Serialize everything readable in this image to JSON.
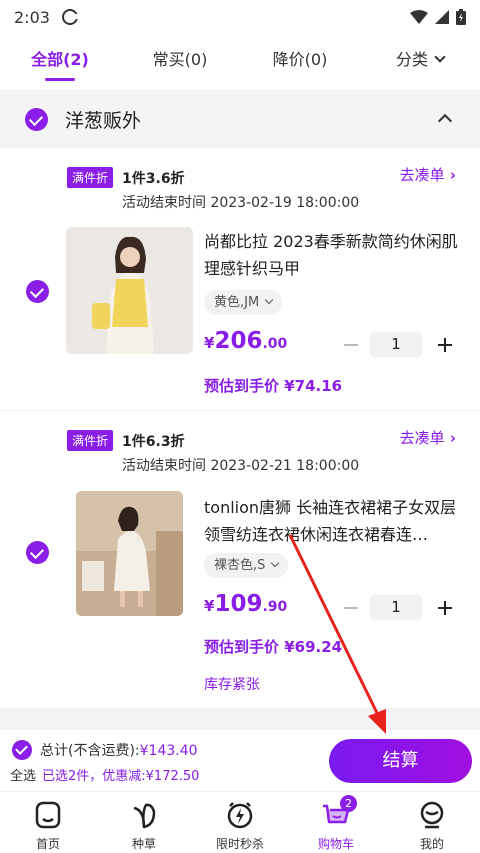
{
  "status_bar": {
    "time": "2:03"
  },
  "tabs": [
    {
      "label": "全部(2)",
      "active": true
    },
    {
      "label": "常买(0)"
    },
    {
      "label": "降价(0)"
    },
    {
      "label": "分类"
    }
  ],
  "store": {
    "name": "洋葱贩外"
  },
  "items": [
    {
      "promo_badge": "满件折",
      "promo_text": "1件3.6折",
      "promo_link": "去凑单",
      "end_time": "活动结束时间 2023-02-19 18:00:00",
      "title": "尚都比拉 2023春季新款简约休闲肌理感针织马甲",
      "variant": "黄色,JM",
      "price_currency": "¥",
      "price_int": "206",
      "price_dec": ".00",
      "quantity": "1",
      "estimate": "预估到手价 ¥74.16"
    },
    {
      "promo_badge": "满件折",
      "promo_text": "1件6.3折",
      "promo_link": "去凑单",
      "end_time": "活动结束时间 2023-02-21 18:00:00",
      "title": "tonlion唐狮 长袖连衣裙裙子女双层领雪纺连衣裙休闲连衣裙春连…",
      "variant": "裸杏色,S",
      "price_currency": "¥",
      "price_int": "109",
      "price_dec": ".90",
      "quantity": "1",
      "estimate": "预估到手价 ¥69.24",
      "stock_note": "库存紧张"
    }
  ],
  "footer": {
    "total_label": "总计(不含运费):",
    "total_value": "¥143.40",
    "select_all": "全选",
    "selected_count": "已选2件，优惠减:¥172.50",
    "checkout": "结算"
  },
  "bottom_nav": [
    {
      "label": "首页",
      "icon": "home-icon"
    },
    {
      "label": "种草",
      "icon": "leaf-icon"
    },
    {
      "label": "限时秒杀",
      "icon": "flash-sale-icon"
    },
    {
      "label": "购物车",
      "icon": "cart-icon",
      "active": true,
      "badge": "2"
    },
    {
      "label": "我的",
      "icon": "profile-icon"
    }
  ],
  "colors": {
    "accent": "#8a1ee6",
    "arrow": "#e8231e"
  }
}
